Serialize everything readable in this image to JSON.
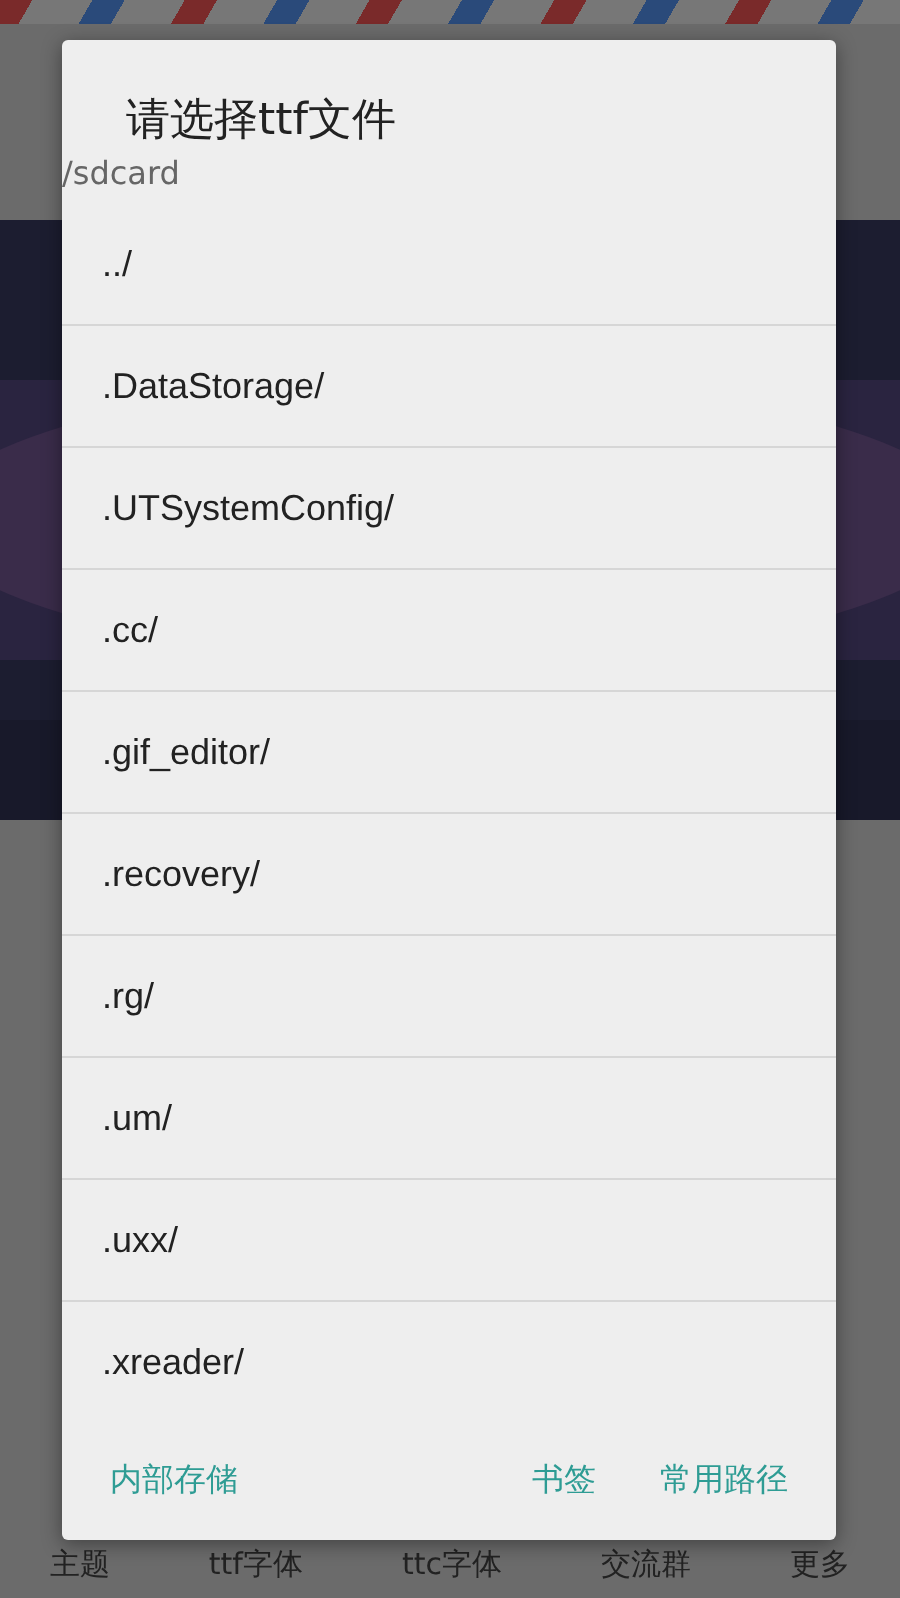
{
  "dialog": {
    "title": "请选择ttf文件",
    "path": "/sdcard",
    "entries": [
      "../",
      ".DataStorage/",
      ".UTSystemConfig/",
      ".cc/",
      ".gif_editor/",
      ".recovery/",
      ".rg/",
      ".um/",
      ".uxx/",
      ".xreader/"
    ],
    "left_buttons": [
      "内部存储"
    ],
    "right_buttons": [
      "书签",
      "常用路径"
    ]
  },
  "bottom_nav": [
    "主题",
    "ttf字体",
    "ttc字体",
    "交流群",
    "更多"
  ]
}
